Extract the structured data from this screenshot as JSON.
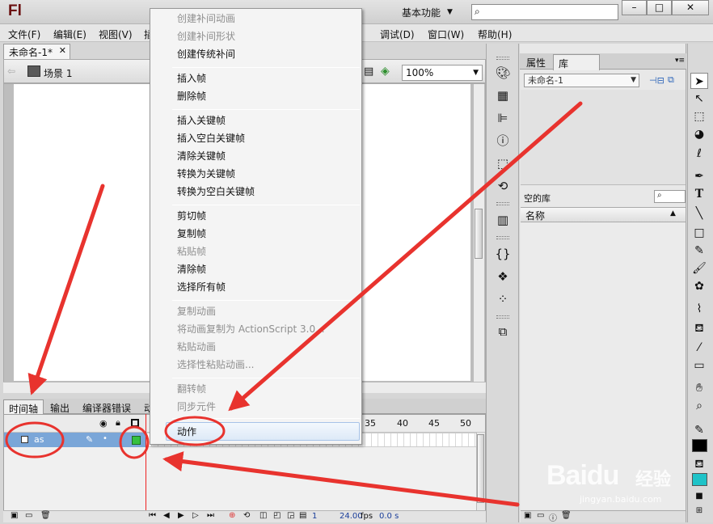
{
  "app": {
    "logo": "Fl",
    "workspace_label": "基本功能",
    "window_buttons": [
      "–",
      "□",
      "✕"
    ]
  },
  "menubar": {
    "items": [
      "文件(F)",
      "编辑(E)",
      "视图(V)",
      "插",
      "调试(D)",
      "窗口(W)",
      "帮助(H)"
    ]
  },
  "document": {
    "tab_label": "未命名-1*",
    "scene_label": "场景 1",
    "zoom": "100%"
  },
  "context_menu": {
    "items": [
      {
        "label": "创建补间动画",
        "disabled": true
      },
      {
        "label": "创建补间形状",
        "disabled": true
      },
      {
        "label": "创建传统补间",
        "disabled": false
      },
      {
        "label": "插入帧",
        "disabled": false
      },
      {
        "label": "删除帧",
        "disabled": false
      },
      {
        "label": "插入关键帧",
        "disabled": false
      },
      {
        "label": "插入空白关键帧",
        "disabled": false
      },
      {
        "label": "清除关键帧",
        "disabled": false
      },
      {
        "label": "转换为关键帧",
        "disabled": false
      },
      {
        "label": "转换为空白关键帧",
        "disabled": false
      },
      {
        "label": "剪切帧",
        "disabled": false
      },
      {
        "label": "复制帧",
        "disabled": false
      },
      {
        "label": "粘贴帧",
        "disabled": true
      },
      {
        "label": "清除帧",
        "disabled": false
      },
      {
        "label": "选择所有帧",
        "disabled": false
      },
      {
        "label": "复制动画",
        "disabled": true
      },
      {
        "label": "将动画复制为 ActionScript 3.0...",
        "disabled": true
      },
      {
        "label": "粘贴动画",
        "disabled": true
      },
      {
        "label": "选择性粘贴动画...",
        "disabled": true
      },
      {
        "label": "翻转帧",
        "disabled": true
      },
      {
        "label": "同步元件",
        "disabled": true
      },
      {
        "label": "动作",
        "disabled": false,
        "highlighted": true
      }
    ]
  },
  "timeline": {
    "tabs": [
      "时间轴",
      "输出",
      "编译器错误",
      "动"
    ],
    "ruler_numbers": [
      "35",
      "40",
      "45",
      "50"
    ],
    "layer_name": "as",
    "current_frame": "1",
    "fps": "24.00",
    "fps_unit": "fps",
    "seconds": "0.0 s"
  },
  "library": {
    "tabs": [
      "属性",
      "库"
    ],
    "document_select": "未命名-1",
    "empty_label": "空的库",
    "column_name": "名称"
  },
  "watermark": {
    "brand": "Baidu",
    "brand_suffix": "经验",
    "url": "jingyan.baidu.com"
  },
  "colors": {
    "annotation_red": "#e8332e",
    "stroke_color": "#000000",
    "fill_color": "#1ec3c8",
    "keyframe_green": "#35c03f",
    "layer_selected": "#7aa6d8"
  }
}
